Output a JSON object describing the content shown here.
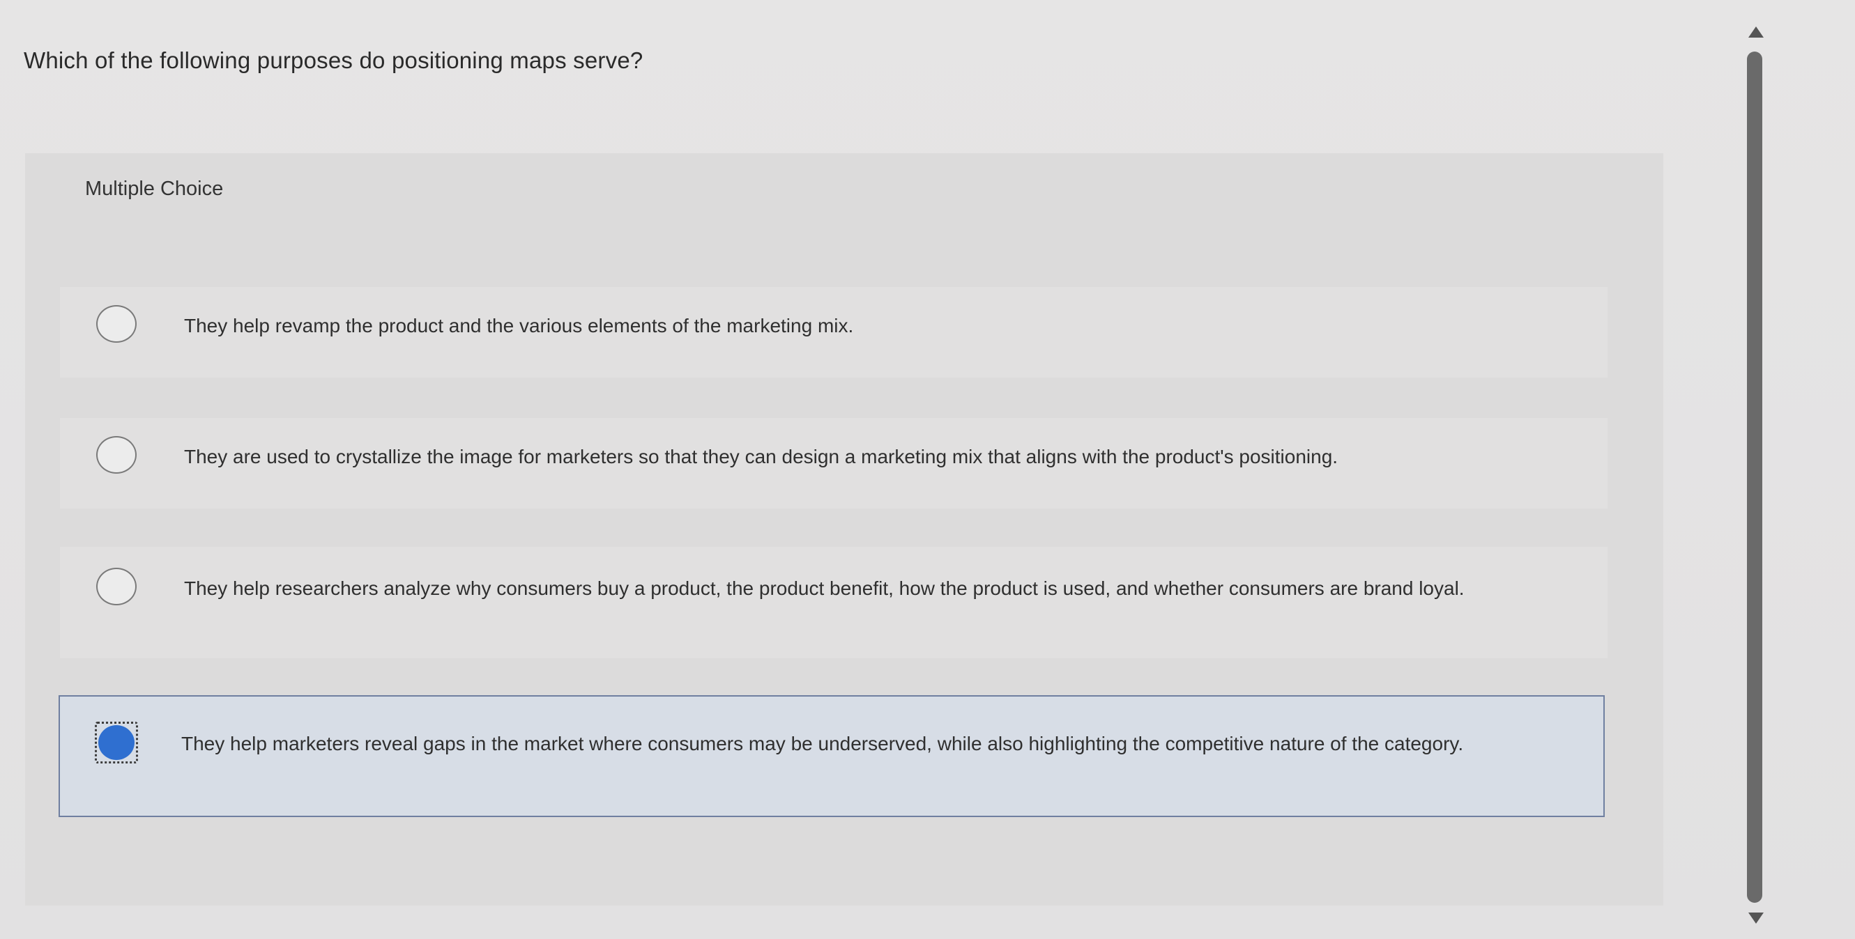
{
  "question": {
    "text": "Which of the following purposes do positioning maps serve?"
  },
  "panel": {
    "label": "Multiple Choice"
  },
  "options": [
    {
      "text": "They help revamp the product and the various elements of the marketing mix.",
      "selected": false
    },
    {
      "text": "They are used to crystallize the image for marketers so that they can design a marketing mix that aligns with the product's positioning.",
      "selected": false
    },
    {
      "text": "They help researchers analyze why consumers buy a product, the product benefit, how the product is used, and whether consumers are brand loyal.",
      "selected": false
    },
    {
      "text": "They help marketers reveal gaps in the market where consumers may be underserved, while also highlighting the competitive nature of the category.",
      "selected": true
    }
  ],
  "colors": {
    "selected_radio": "#2f6fd0",
    "selected_background": "#d7dde6",
    "selected_border": "#6f7fa0"
  }
}
